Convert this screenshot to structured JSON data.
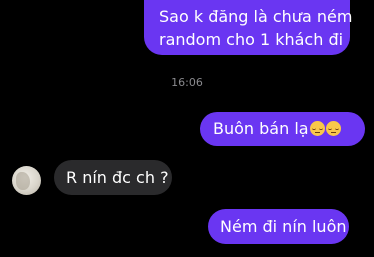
{
  "messages": {
    "first": {
      "line1": "Sao k đăng là chưa ném",
      "line2": "random cho 1 khách đi"
    },
    "timestamp": "16:06",
    "second": {
      "text": "Buôn bán lạ",
      "emoji": "relieved-face-emoji"
    },
    "received": {
      "text": "R nín đc ch ?"
    },
    "last": {
      "text": "Ném đi nín luôn"
    }
  },
  "colors": {
    "background": "#000000",
    "outgoing_bubble": "#6a36f2",
    "incoming_bubble": "#2a2a2c",
    "timestamp": "#8a8a8e",
    "text": "#ffffff"
  },
  "icons": {
    "emoji": "relieved-face-emoji",
    "avatar": "contact-avatar"
  }
}
